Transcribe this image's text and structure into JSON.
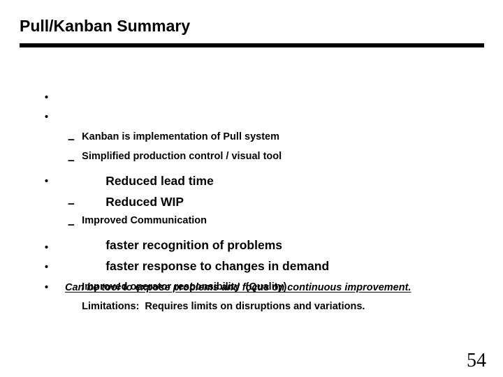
{
  "slide": {
    "title": "Pull/Kanban Summary",
    "page_number": "54",
    "accent_color": "#000000",
    "background_color": "#ffffff",
    "bullet_marker": "•",
    "sub_bullet_marker": "–",
    "items": [
      {
        "level": 1,
        "text": "Kanban is implementation of Pull system"
      },
      {
        "level": 1,
        "text": "Simplified production control / visual tool"
      },
      {
        "level": 2,
        "text": "Reduced lead time"
      },
      {
        "level": 2,
        "text": "Reduced WIP"
      },
      {
        "level": 1,
        "text": "Improved Communication"
      },
      {
        "level": 2,
        "text": "faster recognition of problems"
      },
      {
        "level": 2,
        "text": "faster response to changes in demand"
      },
      {
        "level": 1,
        "text": "Improved operator responsibility  (Quality)"
      },
      {
        "level": 1,
        "text": "Limitations:  Requires limits on disruptions and variations."
      },
      {
        "level": 1,
        "text": "Can be tool to expose problems and focus on  continuous improvement.",
        "style": "italic-underline"
      }
    ]
  }
}
